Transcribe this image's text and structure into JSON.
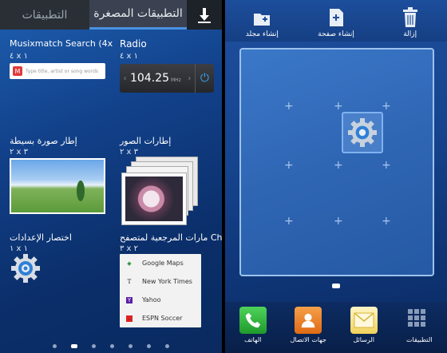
{
  "left_screen": {
    "tabs": {
      "apps_label": "التطبيقات",
      "widgets_label": "التطبيقات المصغرة",
      "download_icon": "download-icon"
    },
    "widgets": [
      {
        "name": "Musixmatch Search (4x",
        "size": "٤ x ١",
        "search_placeholder": "Type title, artist or song words"
      },
      {
        "name": "Radio",
        "size": "٤ x ١",
        "frequency": "104.25",
        "unit": "MHz"
      },
      {
        "name": "إطار صورة بسيطة",
        "size": "٢ x ٣"
      },
      {
        "name": "إطارات الصور",
        "size": "٢ x ٣"
      },
      {
        "name": "اختصار الإعدادات",
        "size": "١ x ١"
      },
      {
        "name": "مارات المرجعية لمتصفح Chrome",
        "size": "٣ x ٢",
        "bookmarks": [
          "Google Maps",
          "New York Times",
          "Yahoo",
          "ESPN Soccer"
        ]
      }
    ],
    "pager": {
      "count": 7,
      "active": 1
    }
  },
  "right_screen": {
    "top_actions": [
      {
        "label": "إنشاء مجلد",
        "icon": "add-folder-icon"
      },
      {
        "label": "إنشاء صفحة",
        "icon": "add-page-icon"
      },
      {
        "label": "إزالة",
        "icon": "trash-icon"
      }
    ],
    "dock": [
      {
        "label": "الهاتف",
        "icon": "phone-icon"
      },
      {
        "label": "جهات الاتصال",
        "icon": "contacts-icon"
      },
      {
        "label": "الرسائل",
        "icon": "messages-icon"
      },
      {
        "label": "التطبيقات",
        "icon": "apps-grid-icon"
      }
    ]
  },
  "colors": {
    "accent": "#4a90e2",
    "wallpaper": "#12418a"
  }
}
